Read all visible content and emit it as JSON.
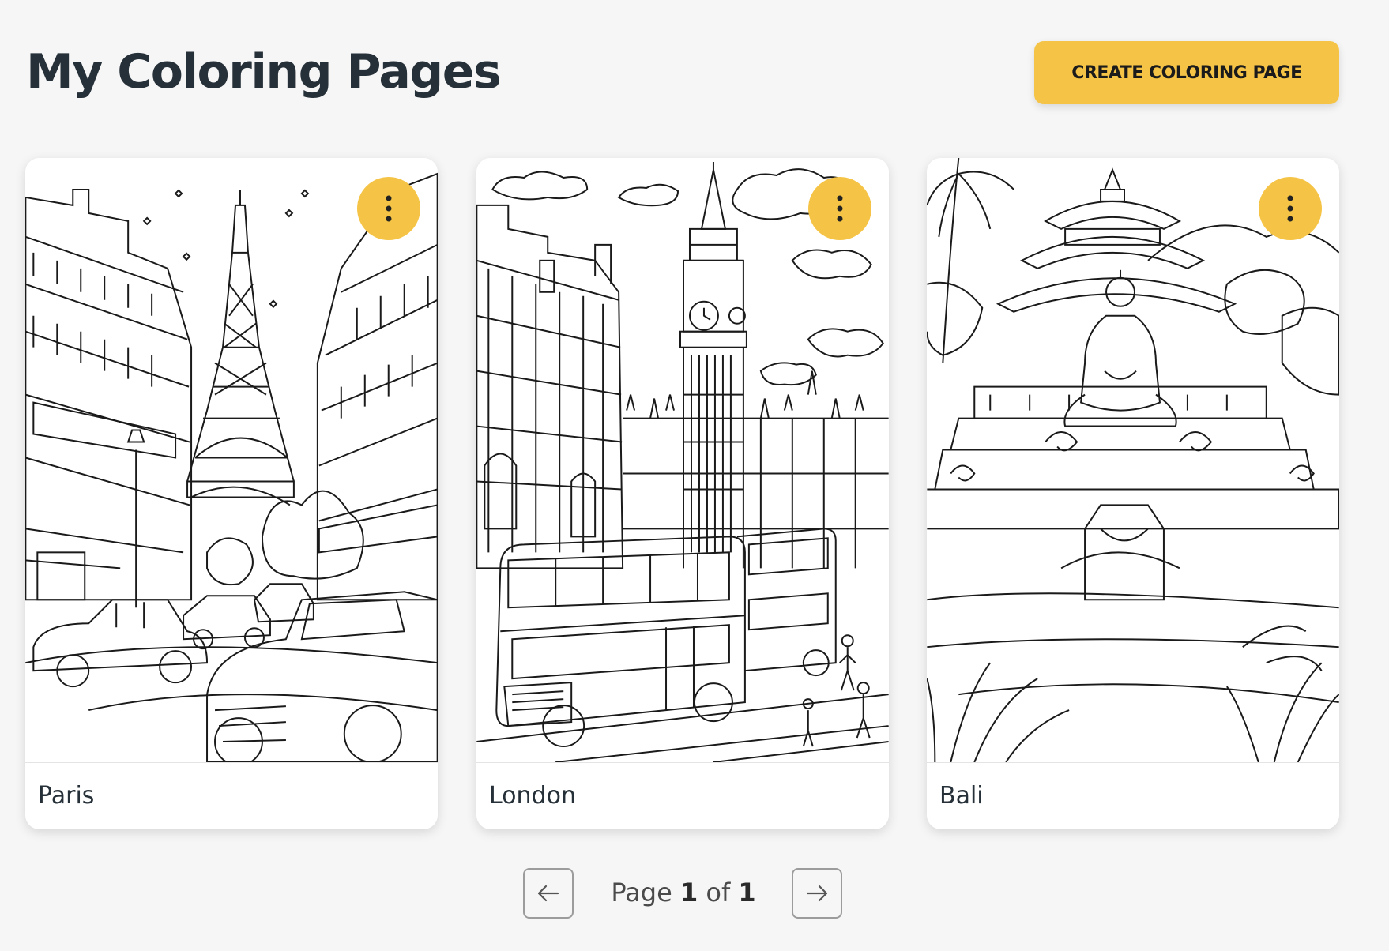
{
  "header": {
    "title": "My Coloring Pages",
    "create_label": "CREATE COLORING PAGE"
  },
  "cards": [
    {
      "label": "Paris",
      "image": "eiffel-tower-street-line-art"
    },
    {
      "label": "London",
      "image": "big-ben-double-decker-bus-line-art"
    },
    {
      "label": "Bali",
      "image": "buddha-temple-jungle-line-art"
    }
  ],
  "pagination": {
    "page_word": "Page",
    "current": "1",
    "of_word": "of",
    "total": "1"
  },
  "colors": {
    "accent": "#f5c446",
    "background": "#f6f6f6",
    "title": "#263038"
  },
  "icons": {
    "menu": "more-vertical-icon",
    "prev": "arrow-left-icon",
    "next": "arrow-right-icon"
  }
}
